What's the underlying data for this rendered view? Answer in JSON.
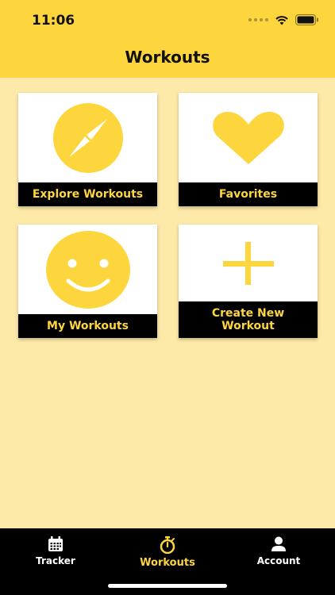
{
  "status": {
    "time": "11:06"
  },
  "header": {
    "title": "Workouts"
  },
  "cards": [
    {
      "label": "Explore Workouts",
      "icon": "compass-icon"
    },
    {
      "label": "Favorites",
      "icon": "heart-icon"
    },
    {
      "label": "My Workouts",
      "icon": "smiley-icon"
    },
    {
      "label": "Create New Workout",
      "icon": "plus-icon"
    }
  ],
  "tabbar": {
    "tabs": [
      {
        "label": "Tracker",
        "icon": "calendar-icon",
        "active": false
      },
      {
        "label": "Workouts",
        "icon": "stopwatch-icon",
        "active": true
      },
      {
        "label": "Account",
        "icon": "person-icon",
        "active": false
      }
    ]
  },
  "colors": {
    "accent": "#fdd53d",
    "background": "#fde9a8",
    "label_bg": "#000000"
  }
}
